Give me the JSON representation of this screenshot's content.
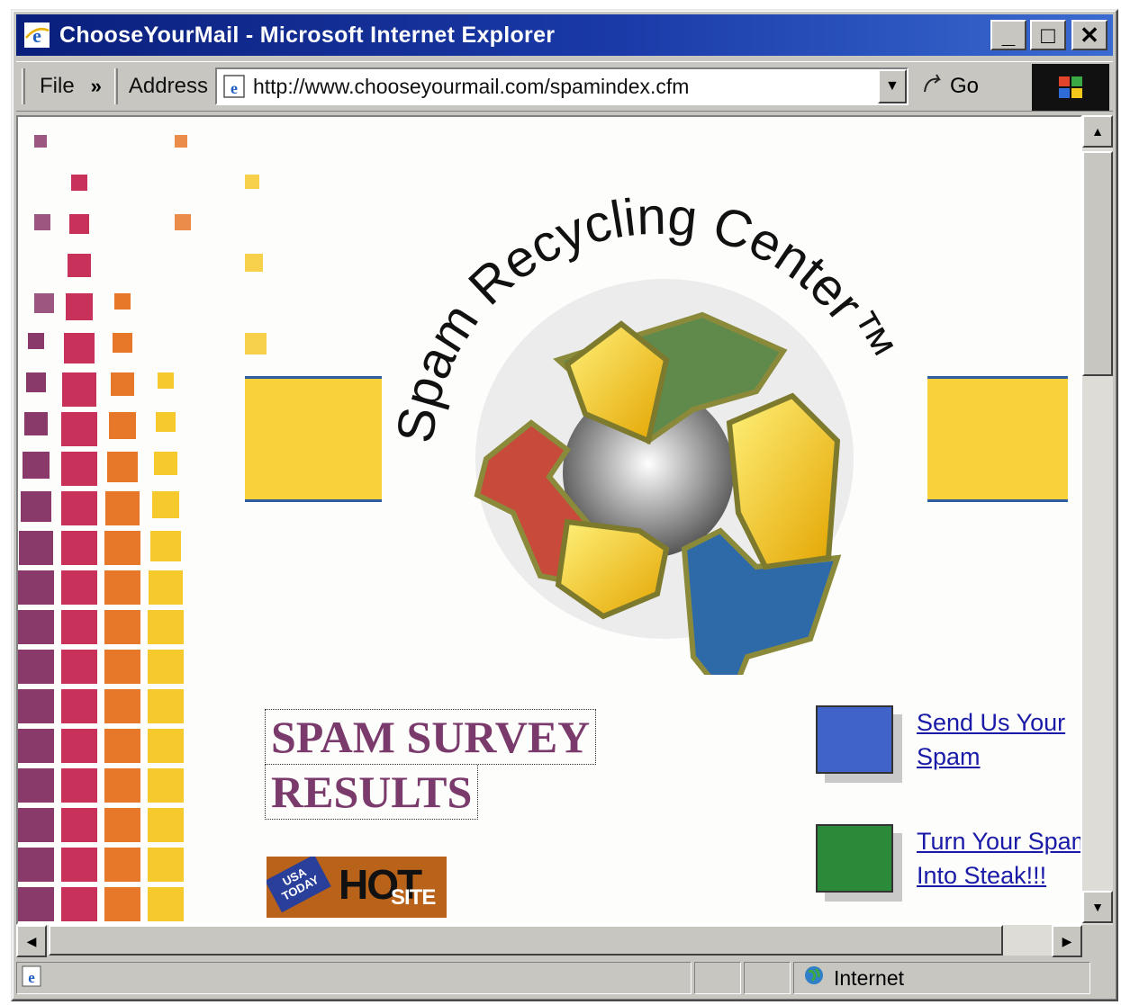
{
  "window": {
    "title": "ChooseYourMail - Microsoft Internet Explorer",
    "buttons": {
      "minimize": "_",
      "maximize": "□",
      "close": "✕"
    }
  },
  "toolbar": {
    "file_menu": "File",
    "chevron": "»",
    "address_label": "Address",
    "url": "http://www.chooseyourmail.com/spamindex.cfm",
    "go_label": "Go"
  },
  "page": {
    "logo_text": "Spam Recycling Center™",
    "survey_line1": "SPAM SURVEY",
    "survey_line2": "RESULTS",
    "badge": {
      "usa": "USA TODAY",
      "hot": "HOT",
      "site": "SITE"
    },
    "side_links": [
      {
        "label": "Send Us Your Spam",
        "color": "#3f63c8"
      },
      {
        "label": "Turn Your Spam Into Steak!!!",
        "color": "#2a8a3a"
      }
    ],
    "colors": {
      "accent_yellow": "#f7d23a",
      "accent_blue": "#2f5d9f",
      "link": "#1a1aa8",
      "survey": "#7a3a6c"
    }
  },
  "status": {
    "zone": "Internet"
  },
  "icons": {
    "app": "ie-logo-icon",
    "address": "ie-page-icon",
    "go": "go-arrow-icon",
    "zone": "globe-icon"
  }
}
